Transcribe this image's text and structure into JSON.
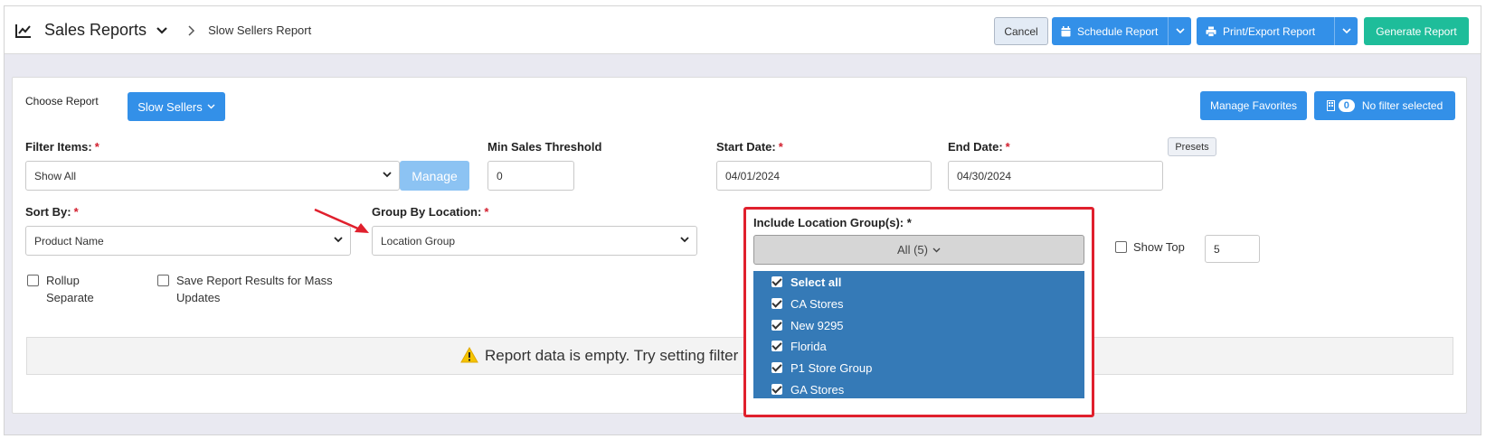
{
  "header": {
    "app_title": "Sales Reports",
    "breadcrumb": "Slow Sellers Report",
    "cancel_label": "Cancel",
    "schedule_label": "Schedule Report",
    "print_label": "Print/Export Report",
    "generate_label": "Generate Report"
  },
  "report_bar": {
    "choose_label": "Choose Report",
    "choose_value": "Slow Sellers",
    "manage_favorites_label": "Manage Favorites",
    "filter_count": "0",
    "filter_label": "No filter selected"
  },
  "filters": {
    "filter_items_label": "Filter Items:",
    "filter_items_value": "Show All",
    "manage_label": "Manage",
    "min_sales_label": "Min Sales Threshold",
    "min_sales_value": "0",
    "start_date_label": "Start Date:",
    "start_date_value": "04/01/2024",
    "end_date_label": "End Date:",
    "end_date_value": "04/30/2024",
    "presets_label": "Presets",
    "sort_by_label": "Sort By:",
    "sort_by_value": "Product Name",
    "group_by_label": "Group By Location:",
    "group_by_value": "Location Group",
    "include_groups_label": "Include Location Group(s): *",
    "include_groups_value": "All (5)",
    "show_top_label": "Show Top",
    "show_top_value": "5",
    "rollup_label_line1": "Rollup",
    "rollup_label_line2": "Separate",
    "save_results_line1": "Save Report Results for Mass",
    "save_results_line2": "Updates",
    "required_mark": "*"
  },
  "location_groups": [
    {
      "label": "Select all",
      "checked": true
    },
    {
      "label": "CA Stores",
      "checked": true
    },
    {
      "label": "New 9295",
      "checked": true
    },
    {
      "label": "Florida",
      "checked": true
    },
    {
      "label": "P1 Store Group",
      "checked": true
    },
    {
      "label": "GA Stores",
      "checked": true
    }
  ],
  "empty_message": "Report data is empty. Try setting filter",
  "colors": {
    "primary": "#3390e8",
    "success": "#1ebd9a",
    "highlight": "#e0202d",
    "list_bg": "#357ab7"
  }
}
